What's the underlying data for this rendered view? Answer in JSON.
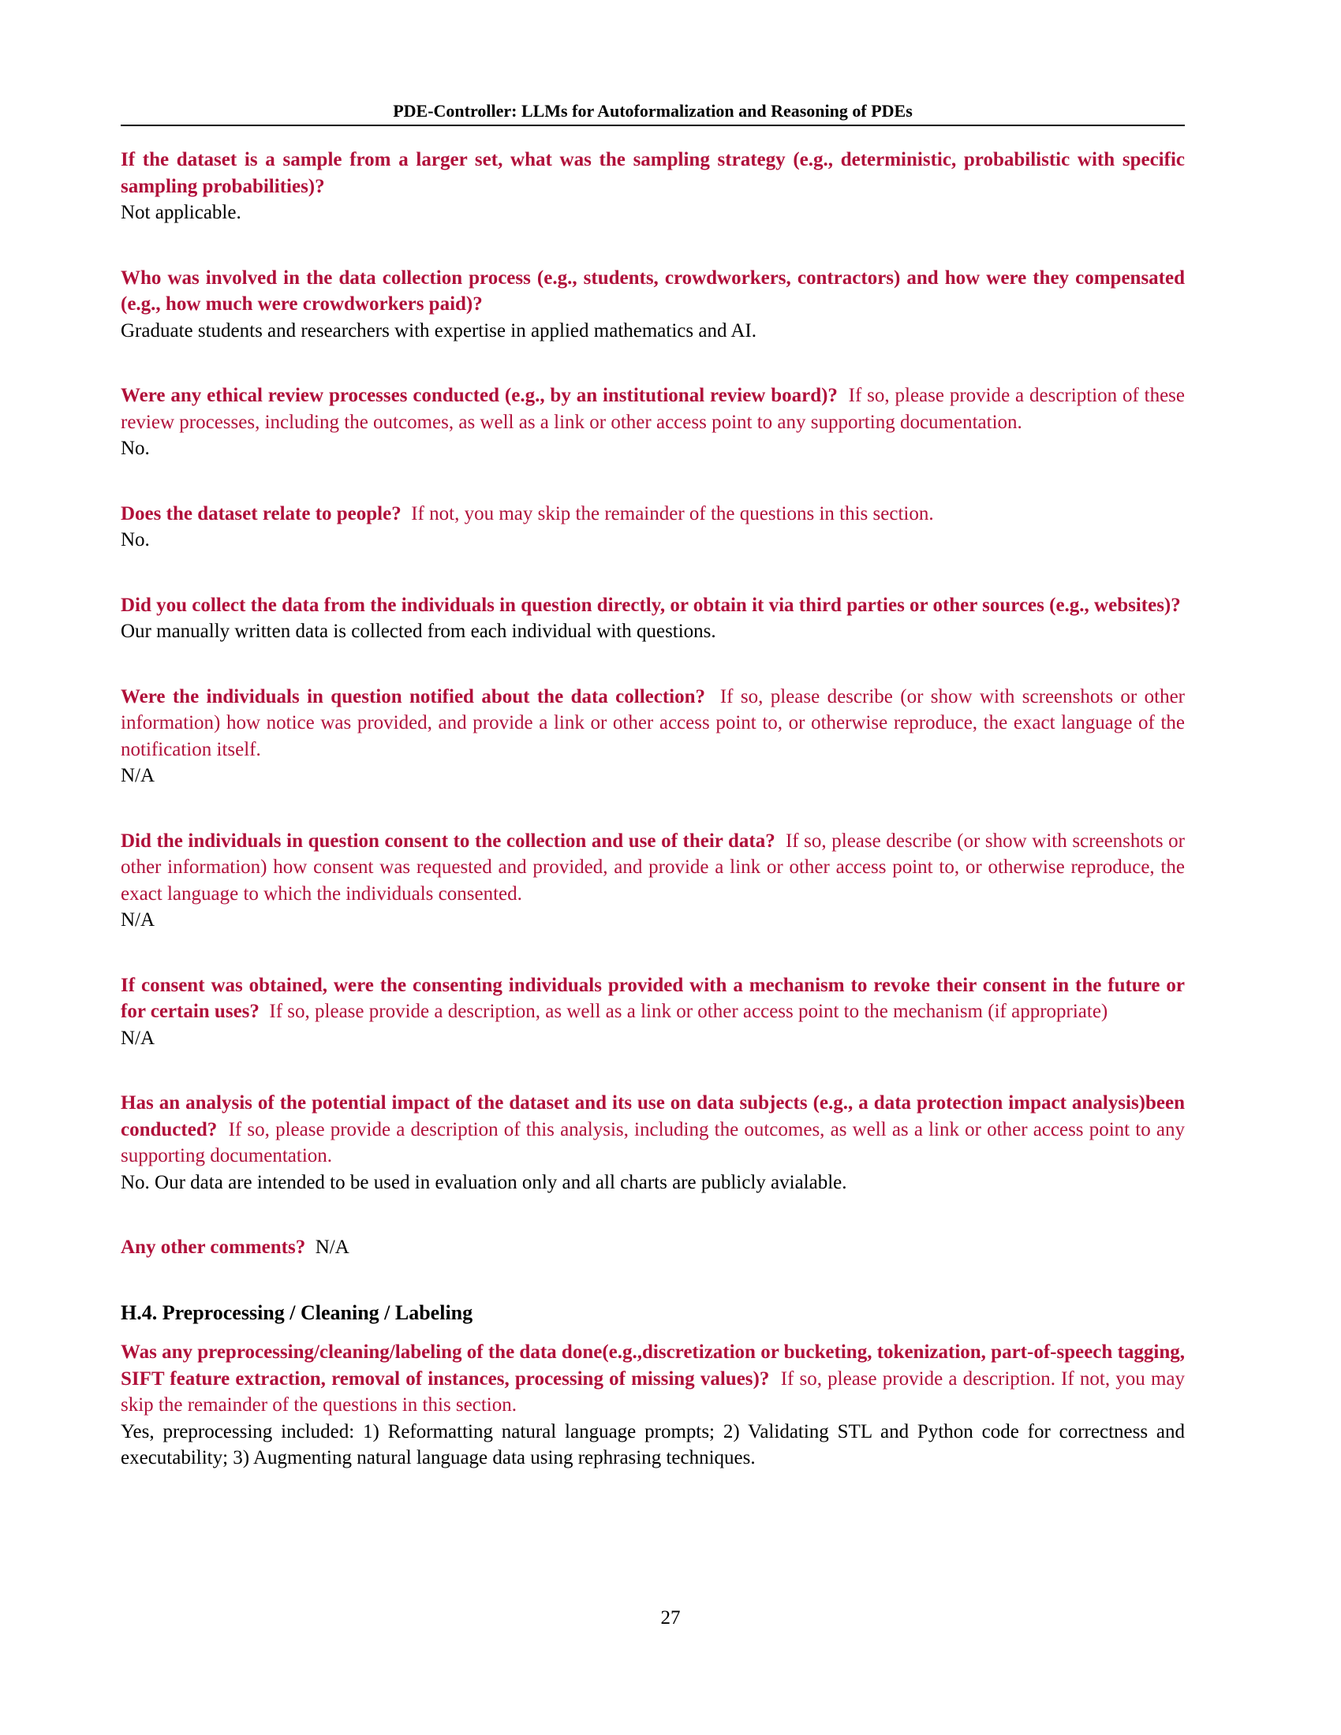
{
  "running_head": "PDE-Controller: LLMs for Autoformalization and Reasoning of PDEs",
  "page_number": "27",
  "qa_items": [
    {
      "question": "If the dataset is a sample from a larger set, what was the sampling strategy (e.g., deterministic, probabilistic with specific sampling probabilities)?",
      "answer": "Not applicable."
    },
    {
      "question": "Who was involved in the data collection process (e.g., students, crowdworkers, contractors) and how were they compensated (e.g., how much were crowdworkers paid)?",
      "answer": "Graduate students and researchers with expertise in applied mathematics and AI."
    },
    {
      "question": "Were any ethical review processes conducted (e.g., by an institutional review board)?",
      "note": "If so, please provide a description of these review processes, including the outcomes, as well as a link or other access point to any supporting documentation.",
      "answer": "No."
    },
    {
      "question": "Does the dataset relate to people?",
      "note": "If not, you may skip the remainder of the questions in this section.",
      "answer": "No."
    },
    {
      "question": "Did you collect the data from the individuals in question directly, or obtain it via third parties or other sources (e.g., websites)?",
      "answer": "Our manually written data is collected from each individual with questions."
    },
    {
      "question": "Were the individuals in question notified about the data collection?",
      "note": "If so, please describe (or show with screenshots or other information) how notice was provided, and provide a link or other access point to, or otherwise reproduce, the exact language of the notification itself.",
      "answer": "N/A"
    },
    {
      "question": "Did the individuals in question consent to the collection and use of their data?",
      "note": "If so, please describe (or show with screenshots or other information) how consent was requested and provided, and provide a link or other access point to, or otherwise reproduce, the exact language to which the individuals consented.",
      "answer": "N/A"
    },
    {
      "question": "If consent was obtained, were the consenting individuals provided with a mechanism to revoke their consent in the future or for certain uses?",
      "note": "If so, please provide a description, as well as a link or other access point to the mechanism (if appropriate)",
      "answer": "N/A"
    },
    {
      "question": "Has an analysis of the potential impact of the dataset and its use on data subjects (e.g., a data protection impact analysis)been conducted?",
      "note": "If so, please provide a description of this analysis, including the outcomes, as well as a link or other access point to any supporting documentation.",
      "answer": "No. Our data are intended to be used in evaluation only and all charts are publicly avialable."
    },
    {
      "question": "Any other comments?",
      "inline_answer": "N/A"
    }
  ],
  "section": {
    "heading": "H.4. Preprocessing / Cleaning / Labeling",
    "qa": {
      "question": "Was any preprocessing/cleaning/labeling of the data done(e.g.,discretization or bucketing, tokenization, part-of-speech tagging, SIFT feature extraction, removal of instances, processing of missing values)?",
      "note": "If so, please provide a description. If not, you may skip the remainder of the questions in this section.",
      "answer": "Yes, preprocessing included: 1) Reformatting natural language prompts; 2) Validating STL and Python code for correctness and executability; 3) Augmenting natural language data using rephrasing techniques."
    }
  }
}
